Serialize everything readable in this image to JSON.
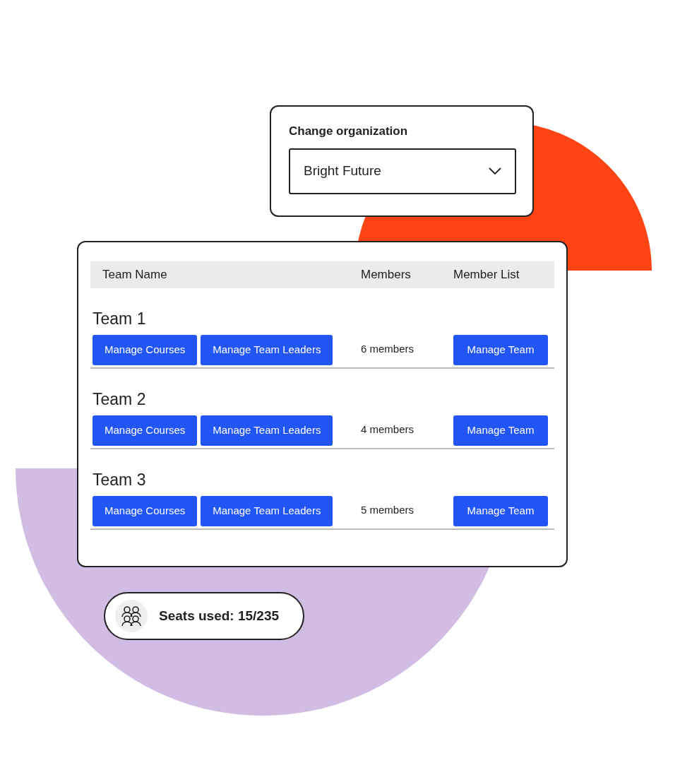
{
  "organization": {
    "label": "Change organization",
    "value": "Bright Future"
  },
  "table": {
    "columns": [
      "Team Name",
      "Members",
      "Member List"
    ],
    "rows": [
      {
        "name": "Team 1",
        "actions": [
          "Manage Courses",
          "Manage Team Leaders"
        ],
        "members": "6 members",
        "member_action": "Manage Team"
      },
      {
        "name": "Team 2",
        "actions": [
          "Manage Courses",
          "Manage Team Leaders"
        ],
        "members": "4 members",
        "member_action": "Manage Team"
      },
      {
        "name": "Team 3",
        "actions": [
          "Manage Courses",
          "Manage Team Leaders"
        ],
        "members": "5 members",
        "member_action": "Manage Team"
      }
    ]
  },
  "seats": {
    "label": "Seats used: 15/235"
  }
}
